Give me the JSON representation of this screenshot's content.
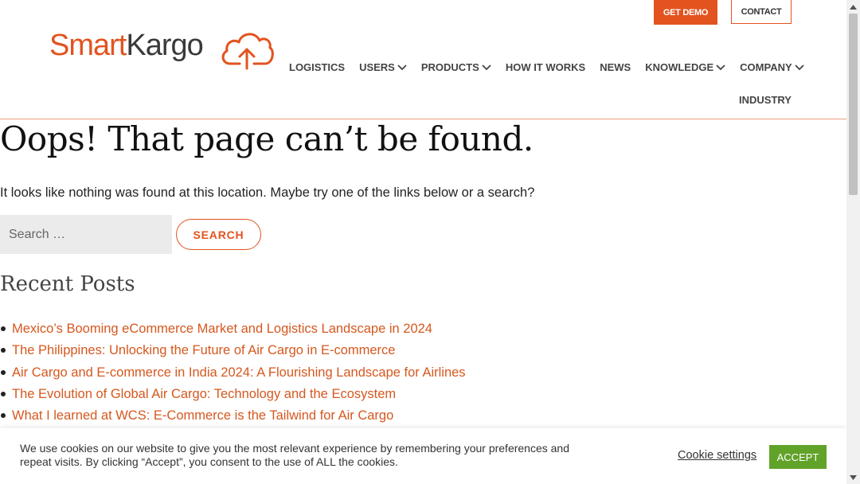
{
  "header": {
    "get_demo": "GET DEMO",
    "contact": "CONTACT",
    "logo": {
      "part1": "Smart",
      "part2": "Kargo"
    },
    "nav": [
      {
        "label": "LOGISTICS",
        "dropdown": false
      },
      {
        "label": "USERS",
        "dropdown": true
      },
      {
        "label": "PRODUCTS",
        "dropdown": true
      },
      {
        "label": "HOW IT WORKS",
        "dropdown": false
      },
      {
        "label": "NEWS",
        "dropdown": false
      },
      {
        "label": "KNOWLEDGE",
        "dropdown": true
      },
      {
        "label": "COMPANY",
        "dropdown": true
      }
    ],
    "nav_industry": "INDUSTRY"
  },
  "main": {
    "title": "Oops! That page can’t be found.",
    "lead": "It looks like nothing was found at this location. Maybe try one of the links below or a search?",
    "search": {
      "placeholder": "Search …",
      "value": "",
      "button": "SEARCH"
    },
    "recent_title": "Recent Posts",
    "posts": [
      "Mexico’s Booming eCommerce Market and Logistics Landscape in 2024",
      "The Philippines: Unlocking the Future of Air Cargo in E-commerce",
      "Air Cargo and E-commerce in India 2024: A Flourishing Landscape for Airlines",
      "The Evolution of Global Air Cargo: Technology and the Ecosystem",
      "What I learned at WCS: E-Commerce is the Tailwind for Air Cargo"
    ]
  },
  "cookie": {
    "text": "We use cookies on our website to give you the most relevant experience by remembering your preferences and repeat visits. By clicking “Accept”, you consent to the use of ALL the cookies.",
    "settings": "Cookie settings",
    "accept": "ACCEPT"
  },
  "colors": {
    "brand": "#e2531f",
    "accept": "#61a229"
  },
  "icons": {
    "nav_dropdown": "chevron-down-icon",
    "logo": "cloud-upload-icon",
    "scroll_up": "arrow-up-icon",
    "scroll_down": "arrow-down-icon"
  }
}
